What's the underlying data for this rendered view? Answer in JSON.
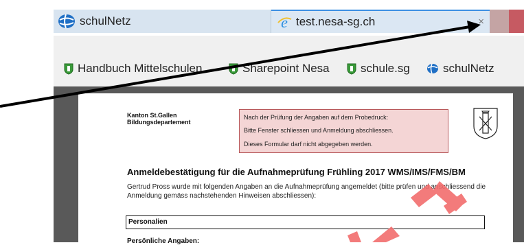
{
  "tabs": [
    {
      "label": "schulNetz",
      "icon": "schulnetz-globe-icon"
    },
    {
      "label": "test.nesa-sg.ch",
      "icon": "ie-icon",
      "active": true,
      "close": "×"
    }
  ],
  "favorites": [
    {
      "label": "Handbuch Mittelschulen",
      "icon": "shield-icon"
    },
    {
      "label": "Sharepoint Nesa",
      "icon": "shield-icon"
    },
    {
      "label": "schule.sg",
      "icon": "shield-icon"
    },
    {
      "label": "schulNetz",
      "icon": "schulnetz-globe-icon"
    }
  ],
  "document": {
    "canton_line1": "Kanton St.Gallen",
    "canton_line2": "Bildungsdepartement",
    "notice_lines": [
      "Nach der Prüfung der Angaben auf dem Probedruck:",
      "Bitte Fenster schliessen und Anmeldung abschliessen.",
      "Dieses Formular darf nicht abgegeben werden."
    ],
    "title": "Anmeldebestätigung für die Aufnahmeprüfung Frühling 2017 WMS/IMS/FMS/BM",
    "intro": "Gertrud Pross wurde mit folgenden Angaben an die Aufnahmeprüfung angemeldet (bitte prüfen und anschliessend die Anmeldung gemäss nachstehenden Hinweisen abschliessen):",
    "section": "Personalien",
    "subsection": "Persönliche Angaben:"
  },
  "colors": {
    "active_tab_accent": "#3c8fe3",
    "notice_bg": "#f4d5d5",
    "notice_border": "#b8585a",
    "watermark": "#f26d6d",
    "viewer_bg": "#595959",
    "window_close": "#c65a62"
  }
}
